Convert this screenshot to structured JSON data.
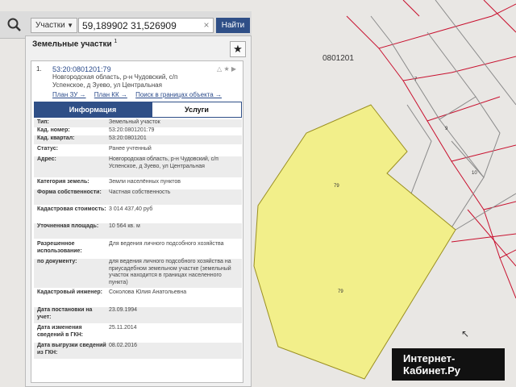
{
  "map": {
    "top_label": "0801201",
    "parcel_numbers": [
      "7",
      "9",
      "10",
      "79",
      "79"
    ]
  },
  "search": {
    "type_label": "Участки",
    "query": "59,189902 31,526909",
    "clear_symbol": "×",
    "find_label": "Найти"
  },
  "panel": {
    "title": "Земельные участки",
    "title_count": "1",
    "star_symbol": "★",
    "card": {
      "index": "1.",
      "cad_number": "53:20:0801201:79",
      "address": "Новгородская область, р-н Чудовский, с/п Успенское, д Зуево, ул Центральная",
      "links": [
        "План ЗУ →",
        "План КК →",
        "Поиск в границах объекта →"
      ],
      "tabs": {
        "info": "Информация",
        "services": "Услуги"
      },
      "rows": [
        {
          "k": "Тип:",
          "v": "Земельный участок"
        },
        {
          "k": "Кад. номер:",
          "v": "53:20:0801201:79"
        },
        {
          "k": "Кад. квартал:",
          "v": "53:20:0801201"
        },
        {
          "k": "Статус:",
          "v": "Ранее учтенный"
        },
        {
          "k": "Адрес:",
          "v": "Новгородская область, р-н Чудовский, с/п Успенское, д Зуево, ул Центральная"
        },
        {
          "k": "Категория земель:",
          "v": "Земли населённых пунктов"
        },
        {
          "k": "Форма собственности:",
          "v": "Частная собственность"
        },
        {
          "k": "Кадастровая стоимость:",
          "v": "3 014 437,40 руб"
        },
        {
          "k": "Уточненная площадь:",
          "v": "10 564 кв. м"
        },
        {
          "k": "Разрешенное использование:",
          "v": "Для ведения личного подсобного хозяйства"
        },
        {
          "k": "по документу:",
          "v": "для ведения личного подсобного хозяйства на приусадебном земельном участке (земельный участок находится в границах населенного пункта)"
        },
        {
          "k": "Кадастровый инженер:",
          "v": "Соколова Юлия Анатольевна"
        },
        {
          "k": "Дата постановки на учет:",
          "v": "23.09.1994"
        },
        {
          "k": "Дата изменения сведений в ГКН:",
          "v": "25.11.2014"
        },
        {
          "k": "Дата выгрузки сведений из ГКН:",
          "v": "08.02.2016"
        }
      ]
    }
  },
  "watermark": {
    "line1": "Интернет-",
    "line2": "Кабинет.Ру"
  },
  "colors": {
    "parcel_fill": "#f2ef8a",
    "accent": "#2f4f87",
    "parcel_border": "#c8102e"
  }
}
